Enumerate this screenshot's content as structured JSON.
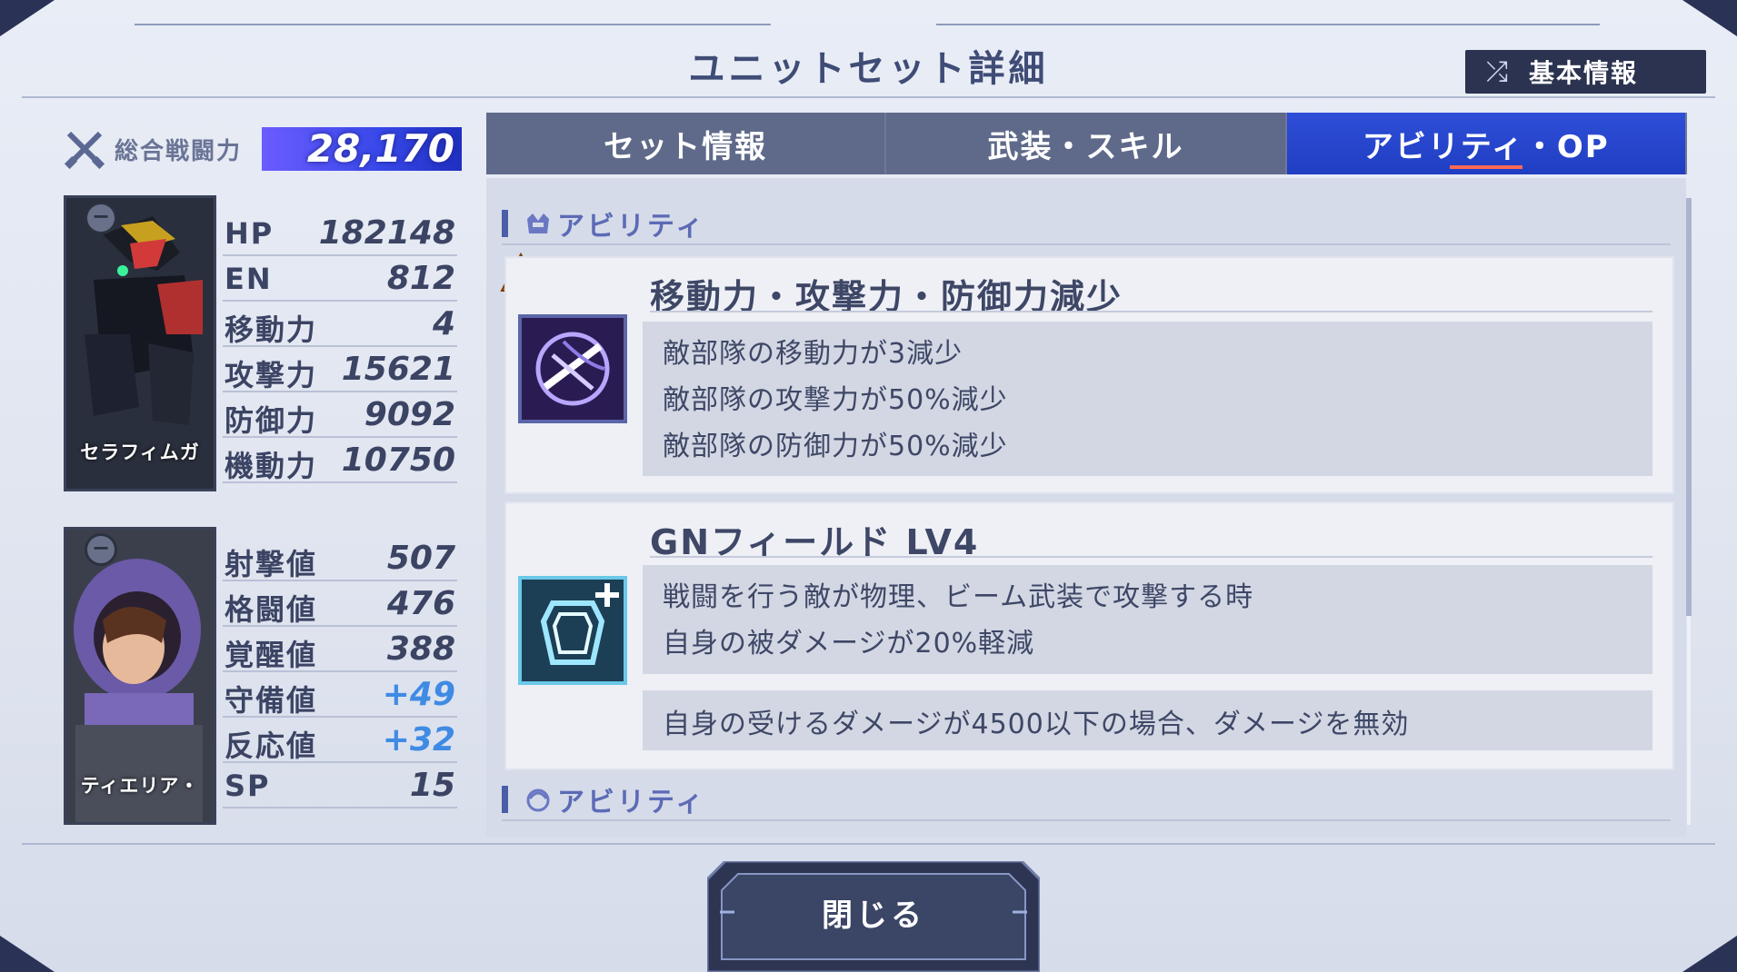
{
  "screen": {
    "title": "ユニットセット詳細",
    "basic_info_button": "基本情報"
  },
  "power": {
    "label": "総合戦闘力",
    "value": "28,170"
  },
  "unit": {
    "name": "セラフィムガ",
    "stats": [
      {
        "key": "HP",
        "value": "182148"
      },
      {
        "key": "EN",
        "value": "812"
      },
      {
        "key": "移動力",
        "value": "4"
      },
      {
        "key": "攻撃力",
        "value": "15621"
      },
      {
        "key": "防御力",
        "value": "9092"
      },
      {
        "key": "機動力",
        "value": "10750"
      }
    ]
  },
  "pilot": {
    "name": "ティエリア・",
    "stats": [
      {
        "key": "射撃値",
        "value": "507"
      },
      {
        "key": "格闘値",
        "value": "476"
      },
      {
        "key": "覚醒値",
        "value": "388"
      },
      {
        "key": "守備値",
        "value": "+49",
        "boosted": true
      },
      {
        "key": "反応値",
        "value": "+32",
        "boosted": true
      },
      {
        "key": "SP",
        "value": "15"
      }
    ]
  },
  "tabs": [
    {
      "label": "セット情報",
      "active": false
    },
    {
      "label": "武装・スキル",
      "active": false
    },
    {
      "label": "アビリティ・OP",
      "active": true
    }
  ],
  "sections": [
    {
      "label": "アビリティ"
    },
    {
      "label": "アビリティ"
    }
  ],
  "abilities": [
    {
      "title": "移動力・攻撃力・防御力減少",
      "icon": "debuff-slash-icon",
      "lines": [
        "敵部隊の移動力が3減少",
        "敵部隊の攻撃力が50%減少",
        "敵部隊の防御力が50%減少"
      ]
    },
    {
      "title": "GNフィールド LV4",
      "icon": "shield-plus-icon",
      "lines": [
        "戦闘を行う敵が物理、ビーム武装で攻撃する時",
        "自身の被ダメージが20%軽減"
      ],
      "extra": "自身の受けるダメージが4500以下の場合、ダメージを無効"
    }
  ],
  "close_button": "閉じる",
  "colors": {
    "accent": "#2f4ed8",
    "boost": "#3f8be4",
    "text": "#3c4464"
  }
}
